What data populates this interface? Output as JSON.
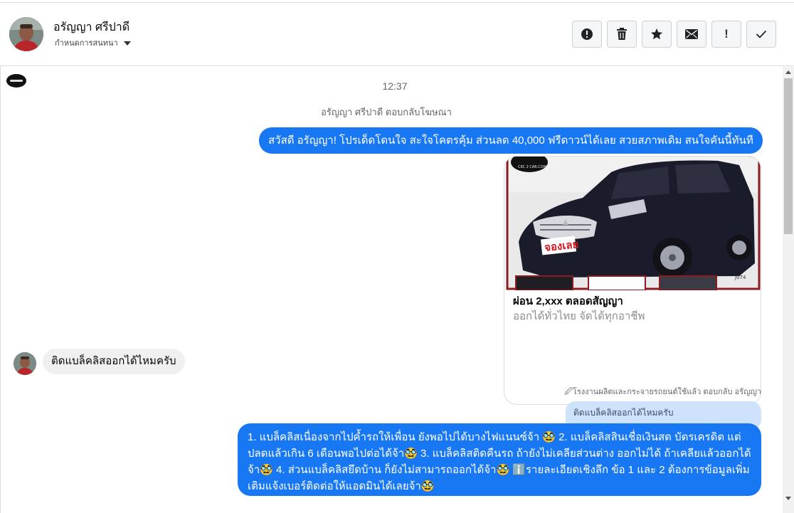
{
  "header": {
    "contact_name": "อรัญญา ศรีปาดี",
    "assign_label": "กำหนดการสนทนา",
    "toolbar": [
      {
        "name": "report-spam-button",
        "icon": "alert-circle-icon"
      },
      {
        "name": "delete-button",
        "icon": "trash-icon"
      },
      {
        "name": "star-button",
        "icon": "star-icon"
      },
      {
        "name": "mark-unread-button",
        "icon": "envelope-icon"
      },
      {
        "name": "mark-important-button",
        "icon": "exclamation-icon",
        "glyph": "!"
      },
      {
        "name": "mark-done-button",
        "icon": "checkmark-icon"
      }
    ]
  },
  "conversation": {
    "time": "12:37",
    "ad_reply_note": "อรัญญา ศรีปาดี ตอบกลับโฆษณา",
    "ad_message": "สวัสดี อรัญญา! โปรเด็ดโดนใจ สะใจโคตรคุ้ม ส่วนลด 40,000 ฟรีดาวน์ได้เลย สวยสภาพเดิม สนใจคันนี้ทันที",
    "ad_card": {
      "title": "ผ่อน 2,xxx ตลอดสัญญา",
      "subtitle": "ออกได้ทั่วไทย จัดได้ทุกอาชีพ",
      "badge": "จองเลย",
      "logo_text": "CKC 2 CAR.COM",
      "stock_code": "J074"
    },
    "incoming_message": "ติดแบล็คลิสออกได้ไหมครับ",
    "reply_meta": "🖉โรงงานผลิตและกระจายรถยนต์ใช้แล้ว ตอบกลับ อรัญญา",
    "quoted_message": "ติดแบล็คลิสออกได้ไหมครับ",
    "reply_message": "1. แบล็คลิสเนื่องจากไปค้ำรถให้เพื่อน ยังพอไปได้บางไฟแนนซ์จ้า 🥸 2. แบล็คลิสสินเชื่อเงินสด บัตรเครดิต แต่ปลดแล้วเกิน 6 เดือนพอไปต่อได้จ้า🥸 3. แบล็คลิสติดคืนรถ ถ้ายังไม่เคลียส่วนต่าง ออกไม่ได้ ถ้าเคลียแล้วออกได้จ้า🥸 4. ส่วนแบล็คลิสยึดบ้าน ก็ยังไม่สามารถออกได้จ้า🥸 ℹ️รายละเอียดเชิงลึก ข้อ 1 และ 2 ต้องการข้อมูลเพิ่มเติมแจ้งเบอร์ติดต่อให้แอดมินได้เลยจ้า🥸"
  },
  "colors": {
    "outgoing_bubble": "#1877f2",
    "incoming_bubble": "#f0f0f0",
    "quoted_bubble": "#cfe2fb",
    "car_body": "#1b1c2b",
    "badge_red": "#d8161d"
  }
}
